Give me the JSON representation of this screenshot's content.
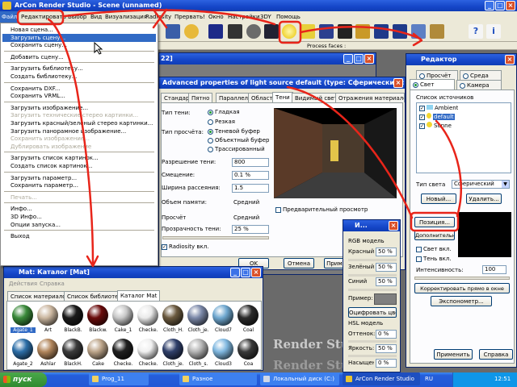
{
  "main_window": {
    "title": "ArCon Render Studio - Scene (unnamed)",
    "menu": [
      "Файл",
      "Редактировать",
      "Выбор",
      "Вид",
      "Визуализация",
      "Radiosity",
      "Прервать!",
      "Окно",
      "Настройки",
      "3DY",
      "Помощь"
    ],
    "process_label": "Process faces :"
  },
  "file_menu": {
    "items": [
      {
        "label": "Новая сцена...",
        "enabled": true
      },
      {
        "label": "Загрузить сцену...",
        "enabled": true,
        "selected": true
      },
      {
        "label": "Сохранить сцену...",
        "enabled": true
      },
      {
        "sep": true
      },
      {
        "label": "Добавить сцену...",
        "enabled": true
      },
      {
        "sep": true
      },
      {
        "label": "Загрузить библиотеку...",
        "enabled": true
      },
      {
        "label": "Создать библиотеку...",
        "enabled": true
      },
      {
        "sep": true
      },
      {
        "label": "Сохранить DXF...",
        "enabled": true
      },
      {
        "label": "Сохранить VRML...",
        "enabled": true
      },
      {
        "sep": true
      },
      {
        "label": "Загрузить изображение...",
        "enabled": true
      },
      {
        "label": "Загрузить технические стерео картинки...",
        "enabled": false
      },
      {
        "label": "Загрузить красный/зеленый стерео картинки...",
        "enabled": true
      },
      {
        "label": "Загрузить панорамное изображение...",
        "enabled": true
      },
      {
        "label": "Сохранить изображение...",
        "enabled": false
      },
      {
        "label": "Дублировать изображение",
        "enabled": false
      },
      {
        "sep": true
      },
      {
        "label": "Загрузить список картинок...",
        "enabled": true
      },
      {
        "label": "Создать список картинок...",
        "enabled": true
      },
      {
        "sep": true
      },
      {
        "label": "Загрузить параметр...",
        "enabled": true
      },
      {
        "label": "Сохранить параметр...",
        "enabled": true
      },
      {
        "sep": true
      },
      {
        "label": "Печать...",
        "enabled": false
      },
      {
        "sep": true
      },
      {
        "label": "Инфо...",
        "enabled": true
      },
      {
        "label": "3D Инфо...",
        "enabled": true
      },
      {
        "label": "Опции запуска...",
        "enabled": true
      },
      {
        "sep": true
      },
      {
        "label": "Выход",
        "enabled": true
      }
    ]
  },
  "viewport": {
    "title_fragment": "22]"
  },
  "light_dialog": {
    "title": "Advanced properties of light source default (type: Сферический):",
    "tabs": [
      "Стандарт",
      "Пятно",
      "Параллель",
      "Область",
      "Тени",
      "Видимый свет",
      "Отражения материалов"
    ],
    "active_tab": "Тени",
    "shadow_type_label": "Тип тени:",
    "shadow_types": [
      "Гладкая",
      "Резкая"
    ],
    "shadow_type_selected": "Гладкая",
    "view_type_label": "Тип просчёта:",
    "view_types": [
      "Теневой буфер",
      "Объектный буфер",
      "Трассированный"
    ],
    "view_type_selected": "Теневой буфер",
    "rows": [
      {
        "label": "Разрешение тени:",
        "value": "800"
      },
      {
        "label": "Смещение:",
        "value": "0.1 %"
      },
      {
        "label": "Ширина рассеяния:",
        "value": "1.5"
      },
      {
        "label": "Объем памяти:",
        "value": "Средний"
      },
      {
        "label": "Просчёт",
        "value": "Средний"
      },
      {
        "label": "Прозрачность тени:",
        "value": "25 %"
      }
    ],
    "radiosity_label": "Radiosity вкл.",
    "preview_label": "Предварительный просмотр",
    "ok": "OK",
    "cancel": "Отмена",
    "apply": "Приме"
  },
  "catalog": {
    "title": "Mat: Каталог  [Mat]",
    "menu": [
      "Действия",
      "Справка"
    ],
    "tabs": [
      "Список материалов",
      "Список библиотек",
      "Каталог Mat"
    ],
    "active_tab": "Каталог Mat",
    "row1": [
      "Agate_1",
      "Art",
      "BlackB.",
      "Blackw.",
      "Cake_1",
      "Checke.",
      "Cloth_H.",
      "Cloth_je.",
      "Cloud7",
      "Coal"
    ],
    "row2": [
      "Agate_2",
      "Ashlar",
      "BlackH.",
      "Cake",
      "Checke.",
      "Checke.",
      "Cloth_je.",
      "Cloth_s.",
      "Cloud3",
      "Coa"
    ]
  },
  "color_panel": {
    "title": "И...",
    "rgb_label": "RGB модель",
    "rgb": [
      {
        "label": "Красный",
        "value": "50 %"
      },
      {
        "label": "Зелёный",
        "value": "50 %"
      },
      {
        "label": "Синий",
        "value": "50 %"
      }
    ],
    "example_label": "Пример:",
    "copy_button": "Оцифровать цвет",
    "hsl_label": "HSL модель",
    "hsl": [
      {
        "label": "Оттенок:",
        "value": "0 %"
      },
      {
        "label": "Яркость:",
        "value": "50 %"
      },
      {
        "label": "Насыщен.",
        "value": "0 %"
      }
    ]
  },
  "editor": {
    "title": "Редактор",
    "tabs_top": [
      "Просчёт",
      "Среда"
    ],
    "tabs_bottom": [
      "Свет",
      "Камера"
    ],
    "active_tab": "Свет",
    "sources_label": "Список источников",
    "sources": [
      {
        "name": "Ambient",
        "checked": true
      },
      {
        "name": "default",
        "checked": true,
        "selected": true
      },
      {
        "name": "Sonne",
        "checked": true
      }
    ],
    "light_type_label": "Тип света",
    "light_type_value": "Сферический",
    "new_button": "Новый...",
    "delete_button": "Удалить...",
    "position_button": "Позиция...",
    "advanced_button": "Дополнительно...",
    "light_on_label": "Свет вкл.",
    "shadow_on_label": "Тень вкл.",
    "intensity_label": "Интенсивность:",
    "intensity_value": "100",
    "correct_button": "Корректировать прямо в окне",
    "exposure_button": "Экспонометр...",
    "apply_button": "Применить",
    "help_button": "Справка"
  },
  "background_text": [
    "Render Stu",
    "Render Studio"
  ],
  "taskbar": {
    "start": "пуск",
    "items": [
      "Prog_11",
      "Разное",
      "Локальный диск (C:)",
      "ArCon Render Studio"
    ],
    "lang": "RU",
    "clock": "12:51"
  },
  "annotation_color": "#e8251a"
}
